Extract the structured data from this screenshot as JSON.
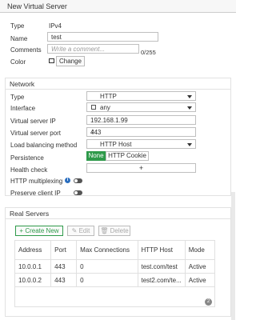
{
  "window": {
    "title": "New Virtual Server"
  },
  "general": {
    "type_label": "Type",
    "type_value": "IPv4",
    "name_label": "Name",
    "name_value": "test",
    "comments_label": "Comments",
    "comments_placeholder": "Write a comment...",
    "comments_counter": "0/255",
    "color_label": "Color",
    "change_button": "Change"
  },
  "network": {
    "heading": "Network",
    "type_label": "Type",
    "type_value": "HTTP",
    "interface_label": "Interface",
    "interface_value": "any",
    "vip_label": "Virtual server IP",
    "vip_value": "192.168.1.99",
    "port_label": "Virtual server port",
    "port_value": "443",
    "lb_label": "Load balancing method",
    "lb_value": "HTTP Host",
    "persistence_label": "Persistence",
    "persistence_options": [
      "None",
      "HTTP Cookie"
    ],
    "persistence_selected": "None",
    "health_label": "Health check",
    "health_add": "+",
    "multiplexing_label": "HTTP multiplexing",
    "multiplexing_on": false,
    "preserve_label": "Preserve client IP",
    "preserve_on": false
  },
  "real_servers": {
    "heading": "Real Servers",
    "create_button": "+ Create New",
    "edit_button": "Edit",
    "delete_button": "Delete",
    "columns": [
      "Address",
      "Port",
      "Max Connections",
      "HTTP Host",
      "Mode"
    ],
    "rows": [
      [
        "10.0.0.1",
        "443",
        "0",
        "test.com/test",
        "Active"
      ],
      [
        "10.0.0.2",
        "443",
        "0",
        "test2.com/te...",
        "Active"
      ]
    ],
    "count": "2"
  },
  "colors": {
    "accent_green": "#2e9a4a",
    "border": "#bfbfbf"
  }
}
